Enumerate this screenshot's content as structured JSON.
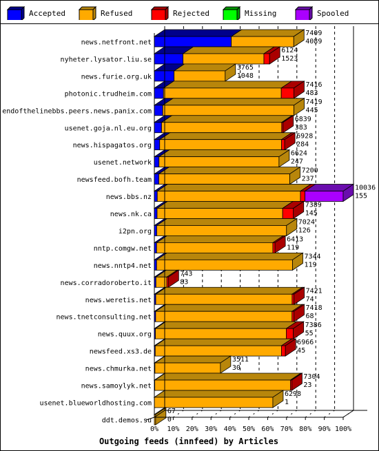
{
  "chart_data": {
    "type": "bar",
    "orientation": "horizontal",
    "stacked": true,
    "style": "3d",
    "title": "",
    "xlabel": "Outgoing feeds (innfeed) by Articles",
    "ylabel": "",
    "x_tick_labels": [
      "0%",
      "10%",
      "20%",
      "30%",
      "40%",
      "50%",
      "60%",
      "70%",
      "80%",
      "90%",
      "100%"
    ],
    "xlim_articles": [
      0,
      10036
    ],
    "grid": true,
    "legend_position": "top",
    "legend": [
      {
        "name": "Accepted",
        "color": "#0000ff",
        "side": "#00008b"
      },
      {
        "name": "Refused",
        "color": "#ffaa00",
        "side": "#b8860b"
      },
      {
        "name": "Rejected",
        "color": "#ff0000",
        "side": "#aa0000"
      },
      {
        "name": "Missing",
        "color": "#00ff00",
        "side": "#009900"
      },
      {
        "name": "Spooled",
        "color": "#aa00ff",
        "side": "#6a0dad"
      }
    ],
    "categories": [
      "news.netfront.net",
      "nyheter.lysator.liu.se",
      "news.furie.org.uk",
      "photonic.trudheim.com",
      "endofthelinebbs.peers.news.panix.com",
      "usenet.goja.nl.eu.org",
      "news.hispagatos.org",
      "usenet.network",
      "newsfeed.bofh.team",
      "news.bbs.nz",
      "news.nk.ca",
      "i2pn.org",
      "nntp.comgw.net",
      "news.nntp4.net",
      "news.corradoroberto.it",
      "news.weretis.net",
      "news.tnetconsulting.net",
      "news.quux.org",
      "newsfeed.xs3.de",
      "news.chmurka.net",
      "news.samoylyk.net",
      "usenet.blueworldhosting.com",
      "ddt.demos.su"
    ],
    "offered_labels": [
      "7409",
      "6124",
      "3765",
      "7416",
      "7419",
      "6839",
      "6928",
      "6624",
      "7200",
      "10036",
      "7389",
      "7024",
      "6413",
      "7344",
      "743",
      "7421",
      "7418",
      "7386",
      "6966",
      "3511",
      "7304",
      "6298",
      "67"
    ],
    "accepted_labels": [
      "4089",
      "1523",
      "1048",
      "483",
      "445",
      "383",
      "284",
      "247",
      "237",
      "155",
      "145",
      "126",
      "119",
      "119",
      "83",
      "74",
      "68",
      "55",
      "45",
      "30",
      "23",
      "1",
      "0"
    ],
    "series": [
      {
        "name": "Accepted",
        "values": [
          4089,
          1523,
          1048,
          483,
          445,
          383,
          284,
          247,
          237,
          155,
          145,
          126,
          119,
          119,
          83,
          74,
          68,
          55,
          45,
          30,
          23,
          1,
          0
        ]
      },
      {
        "name": "Refused",
        "values": [
          3320,
          4300,
          2717,
          6263,
          6974,
          6386,
          6474,
          6377,
          6963,
          7610,
          6674,
          6898,
          6181,
          7225,
          580,
          7247,
          7250,
          6956,
          6711,
          3481,
          7211,
          6297,
          67
        ]
      },
      {
        "name": "Rejected",
        "values": [
          0,
          301,
          0,
          670,
          0,
          70,
          170,
          0,
          0,
          240,
          570,
          0,
          113,
          0,
          80,
          100,
          100,
          375,
          210,
          0,
          70,
          0,
          0
        ]
      },
      {
        "name": "Missing",
        "values": [
          0,
          0,
          0,
          0,
          0,
          0,
          0,
          0,
          0,
          0,
          0,
          0,
          0,
          0,
          0,
          0,
          0,
          0,
          0,
          0,
          0,
          0,
          0
        ]
      },
      {
        "name": "Spooled",
        "values": [
          0,
          0,
          0,
          0,
          0,
          0,
          0,
          0,
          0,
          2031,
          0,
          0,
          0,
          0,
          0,
          0,
          0,
          0,
          0,
          0,
          0,
          0,
          0
        ]
      }
    ]
  }
}
